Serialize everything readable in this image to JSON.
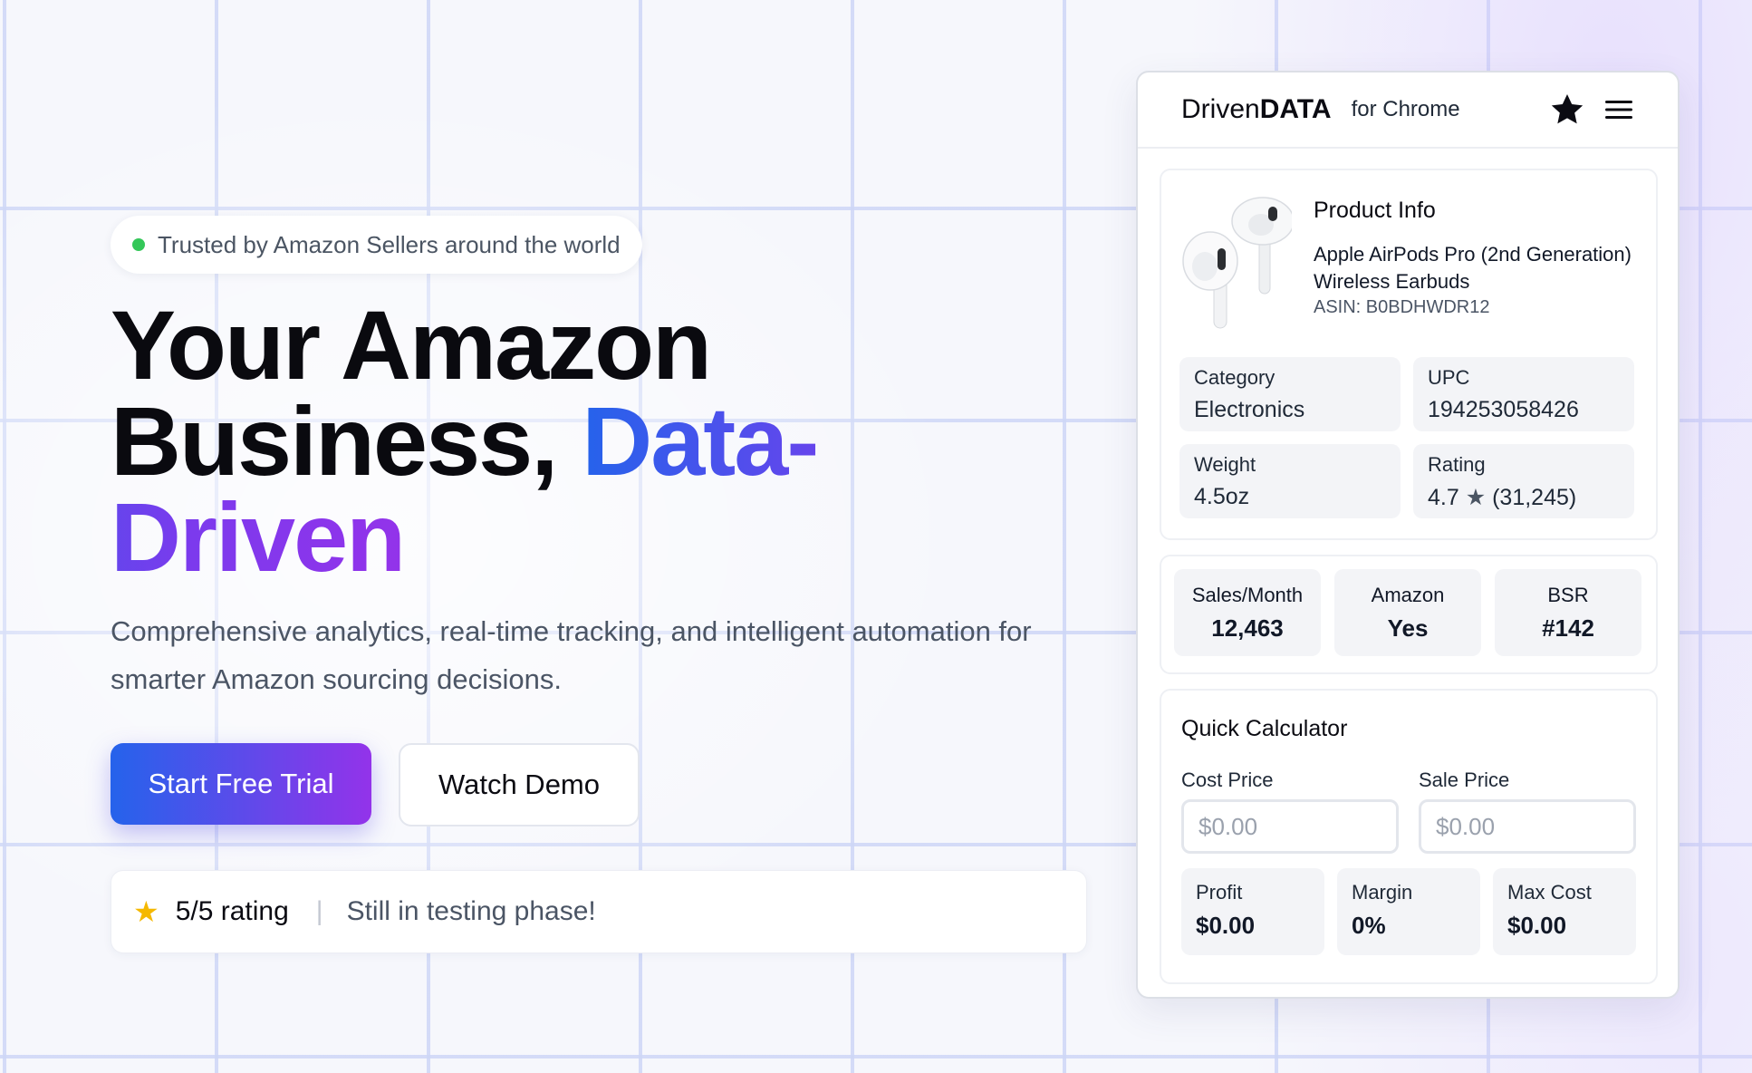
{
  "hero": {
    "trust_badge": "Trusted by Amazon Sellers around the world",
    "headline_line1": "Your Amazon",
    "headline_line2_plain": "Business,",
    "headline_line2_accent": "Data-Driven",
    "subtext": "Comprehensive analytics, real-time tracking, and intelligent automation for smarter Amazon sourcing decisions.",
    "primary_cta": "Start Free Trial",
    "secondary_cta": "Watch Demo",
    "rating_label": "5/5 rating",
    "rating_separator": "|",
    "testing_note": "Still in testing phase!",
    "colors": {
      "gradient_start": "#2563eb",
      "gradient_end": "#9333ea",
      "status_dot": "#34c759",
      "star": "#f5b800"
    }
  },
  "extension": {
    "brand_regular": "Driven",
    "brand_bold": "DATA",
    "brand_sub": "for Chrome",
    "header_icons": [
      "star-icon",
      "menu-icon"
    ],
    "product": {
      "title": "Product Info",
      "name": "Apple AirPods Pro (2nd Generation) Wireless Earbuds",
      "asin": "ASIN: B0BDHWDR12",
      "image": "airpods-image"
    },
    "specs": [
      {
        "label": "Category",
        "value": "Electronics"
      },
      {
        "label": "UPC",
        "value": "194253058426"
      },
      {
        "label": "Weight",
        "value": "4.5oz"
      },
      {
        "label": "Rating",
        "value_score": "4.7",
        "value_star": "★",
        "value_count": "(31,245)"
      }
    ],
    "stats": [
      {
        "label": "Sales/Month",
        "value": "12,463"
      },
      {
        "label": "Amazon",
        "value": "Yes"
      },
      {
        "label": "BSR",
        "value": "#142"
      }
    ],
    "calculator": {
      "title": "Quick Calculator",
      "cost_label": "Cost Price",
      "cost_placeholder": "$0.00",
      "sale_label": "Sale Price",
      "sale_placeholder": "$0.00",
      "results": [
        {
          "label": "Profit",
          "value": "$0.00"
        },
        {
          "label": "Margin",
          "value": "0%"
        },
        {
          "label": "Max Cost",
          "value": "$0.00"
        }
      ]
    }
  }
}
